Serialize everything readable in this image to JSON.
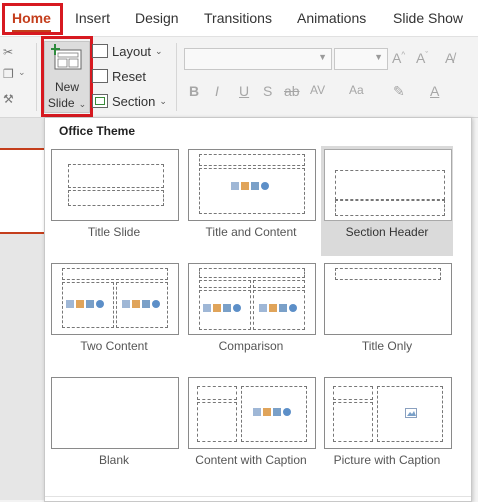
{
  "tabs": [
    "Home",
    "Insert",
    "Design",
    "Transitions",
    "Animations",
    "Slide Show"
  ],
  "ribbon": {
    "new_slide_line1": "New",
    "new_slide_line2": "Slide",
    "layout_label": "Layout",
    "reset_label": "Reset",
    "section_label": "Section"
  },
  "format_buttons": [
    "B",
    "I",
    "U",
    "S",
    "ab",
    "AV",
    "Aa",
    "A"
  ],
  "gallery": {
    "title": "Office Theme",
    "layouts": [
      {
        "label": "Title Slide"
      },
      {
        "label": "Title and Content"
      },
      {
        "label": "Section Header",
        "selected": true
      },
      {
        "label": "Two Content"
      },
      {
        "label": "Comparison"
      },
      {
        "label": "Title Only"
      },
      {
        "label": "Blank"
      },
      {
        "label": "Content with Caption"
      },
      {
        "label": "Picture with Caption"
      }
    ]
  },
  "colors": {
    "accent": "#c43e1c",
    "highlight_box": "#d71920"
  }
}
